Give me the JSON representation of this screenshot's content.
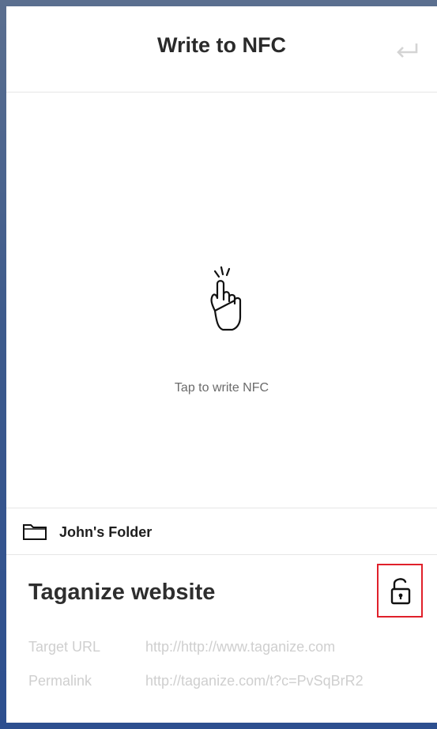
{
  "header": {
    "title": "Write to NFC",
    "back_icon": "return-arrow-icon"
  },
  "tap_area": {
    "icon": "tap-hand-icon",
    "text": "Tap to write NFC"
  },
  "folder": {
    "icon": "folder-icon",
    "name": "John's Folder"
  },
  "item": {
    "title": "Taganize website",
    "lock_icon": "unlocked-padlock-icon",
    "highlight_color": "#e0202a",
    "fields": [
      {
        "label": "Target URL",
        "value": "http://http://www.taganize.com"
      },
      {
        "label": "Permalink",
        "value": "http://taganize.com/t?c=PvSqBrR2"
      }
    ]
  }
}
